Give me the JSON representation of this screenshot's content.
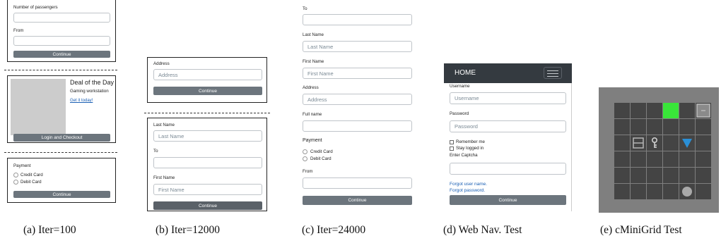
{
  "panel_a": {
    "passengers_label": "Number of passengers",
    "from_label": "From",
    "continue_1": "Continue",
    "deal_title": "Deal of the Day",
    "deal_subtitle": "Gaming workstation",
    "deal_link": "Get it today!",
    "login_checkout": "Login and Checkout",
    "payment_label": "Payment",
    "credit_card": "Credit Card",
    "debit_card": "Debit Card",
    "continue_2": "Continue"
  },
  "panel_b": {
    "address_label": "Address",
    "address_placeholder": "Address",
    "continue_1": "Continue",
    "last_name_label": "Last Name",
    "last_name_placeholder": "Last Name",
    "to_label": "To",
    "first_name_label": "First Name",
    "first_name_placeholder": "First Name",
    "continue_2": "Continue"
  },
  "panel_c": {
    "to_label": "To",
    "last_name_label": "Last Name",
    "last_name_placeholder": "Last Name",
    "first_name_label": "First Name",
    "first_name_placeholder": "First Name",
    "address_label": "Address",
    "address_placeholder": "Address",
    "full_name_label": "Full name",
    "payment_label": "Payment",
    "credit_card": "Credit Card",
    "debit_card": "Debit Card",
    "from_label": "From",
    "continue": "Continue"
  },
  "panel_d": {
    "home": "HOME",
    "username_label": "Username",
    "username_placeholder": "Username",
    "password_label": "Password",
    "password_placeholder": "Password",
    "remember_me": "Remember me",
    "stay_logged_in": "Stay logged in",
    "captcha_label": "Enter Captcha",
    "forgot_username": "Forgot user name.",
    "forgot_password": "Forgot password.",
    "continue": "Continue"
  },
  "panel_e": {
    "colors": {
      "goal": "#39e639",
      "agent": "#2a8fd6",
      "wall": "#7f7f7f",
      "floor": "#444444"
    },
    "icons": [
      "door-icon",
      "key-icon",
      "agent-triangle-icon",
      "ball-icon",
      "locked-box-icon"
    ]
  },
  "captions": {
    "a": "(a) Iter=100",
    "b": "(b) Iter=12000",
    "c": "(c) Iter=24000",
    "d": "(d) Web Nav. Test",
    "e": "(e) cMiniGrid Test"
  }
}
